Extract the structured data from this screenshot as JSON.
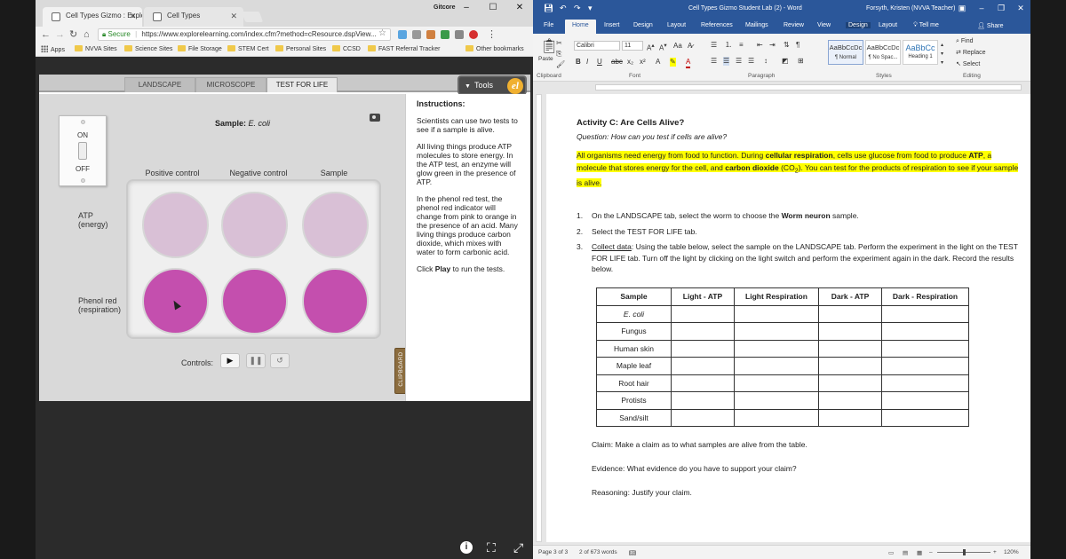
{
  "chrome": {
    "tabs": [
      {
        "title": "Cell Types Gizmo : Explo",
        "active": true
      },
      {
        "title": "Cell Types",
        "active": false
      }
    ],
    "user": "Gitcore",
    "address": {
      "secure_label": "Secure",
      "url": "https://www.explorelearning.com/index.cfm?method=cResource.dspView..."
    },
    "bookmarks": [
      "Apps",
      "NVVA Sites",
      "Science Sites",
      "File Storage",
      "STEM Cert",
      "Personal Sites",
      "CCSD",
      "FAST Referral Tracker",
      "Other bookmarks"
    ]
  },
  "gizmo": {
    "tabs": [
      "LANDSCAPE",
      "MICROSCOPE",
      "TEST FOR LIFE"
    ],
    "active_tab": "TEST FOR LIFE",
    "tools_label": "Tools",
    "switch": {
      "on": "ON",
      "off": "OFF"
    },
    "sample": {
      "prefix": "Sample:",
      "name": "E. coli"
    },
    "columns": [
      "Positive control",
      "Negative control",
      "Sample"
    ],
    "rows": [
      {
        "line1": "ATP",
        "line2": "(energy)"
      },
      {
        "line1": "Phenol red",
        "line2": "(respiration)"
      }
    ],
    "controls_label": "Controls:",
    "clipboard_label": "CLIPBOARD",
    "instructions": {
      "heading": "Instructions:",
      "paragraphs": [
        "Scientists can use two tests to see if a sample is alive.",
        "All living things produce ATP molecules to store energy. In the ATP test, an enzyme will glow green in the presence of ATP.",
        "In the phenol red test, the phenol red indicator will change from pink to orange in the presence of an acid. Many living things produce carbon dioxide, which mixes with water to form carbonic acid."
      ],
      "final_prefix": "Click ",
      "final_bold": "Play",
      "final_suffix": " to run the tests."
    },
    "colors": {
      "atp_well": "#d9c0d6",
      "phenol_well": "#c44fae"
    }
  },
  "word": {
    "title": "Cell Types Gizmo Student Lab (2) - Word",
    "user": "Forsyth, Kristen (NVVA Teacher)",
    "tabs": [
      "File",
      "Home",
      "Insert",
      "Design",
      "Layout",
      "References",
      "Mailings",
      "Review",
      "View",
      "Design",
      "Layout",
      "Tell me",
      "Share"
    ],
    "active_tab": "Home",
    "ribbon": {
      "font": "Calibri",
      "size": "11",
      "paste": "Paste",
      "styles": [
        {
          "preview": "AaBbCcDc",
          "name": "¶ Normal"
        },
        {
          "preview": "AaBbCcDc",
          "name": "¶ No Spac..."
        },
        {
          "preview": "AaBbCc",
          "name": "Heading 1"
        }
      ],
      "editing": [
        "Find",
        "Replace",
        "Select"
      ],
      "groups": [
        "Clipboard",
        "Font",
        "Paragraph",
        "Styles",
        "Editing"
      ]
    },
    "doc": {
      "title": "Activity C: Are Cells Alive?",
      "question": "Question: How can you test if cells are alive?",
      "highlight": {
        "t1": "All organisms need energy from food to function. During ",
        "b1": "cellular respiration",
        "t2": ", cells use glucose from food to produce ",
        "b2": "ATP",
        "t3": ", a molecule that stores energy for the cell, and ",
        "b3": "carbon dioxide",
        "t4": " (CO",
        "sub": "2",
        "t5": "). You can test for the products of respiration to see if your sample is alive."
      },
      "steps": [
        {
          "num": "1.",
          "pre": "On the LANDSCAPE tab, select the worm to choose the ",
          "bold": "Worm neuron",
          "post": " sample."
        },
        {
          "num": "2.",
          "pre": "Select the TEST FOR LIFE tab.",
          "bold": "",
          "post": ""
        },
        {
          "num": "3.",
          "underline": "Collect data",
          "pre": ": Using the table below, select the sample on the LANDSCAPE tab. Perform the experiment in the light on the TEST FOR LIFE tab. Turn off the light by clicking on the light switch and perform the experiment again in the dark. Record the results below.",
          "bold": "",
          "post": ""
        }
      ],
      "table": {
        "headers": [
          "Sample",
          "Light - ATP",
          "Light Respiration",
          "Dark - ATP",
          "Dark - Respiration"
        ],
        "rows": [
          "E. coli",
          "Fungus",
          "Human skin",
          "Maple leaf",
          "Root hair",
          "Protists",
          "Sand/silt"
        ]
      },
      "claim": "Claim: Make a claim as to what samples are alive from the table.",
      "evidence": "Evidence: What evidence do you have to support your claim?",
      "reasoning": "Reasoning: Justify your claim."
    },
    "status": {
      "page": "Page 3 of 3",
      "words": "2 of 673 words",
      "zoom": "120%"
    }
  }
}
